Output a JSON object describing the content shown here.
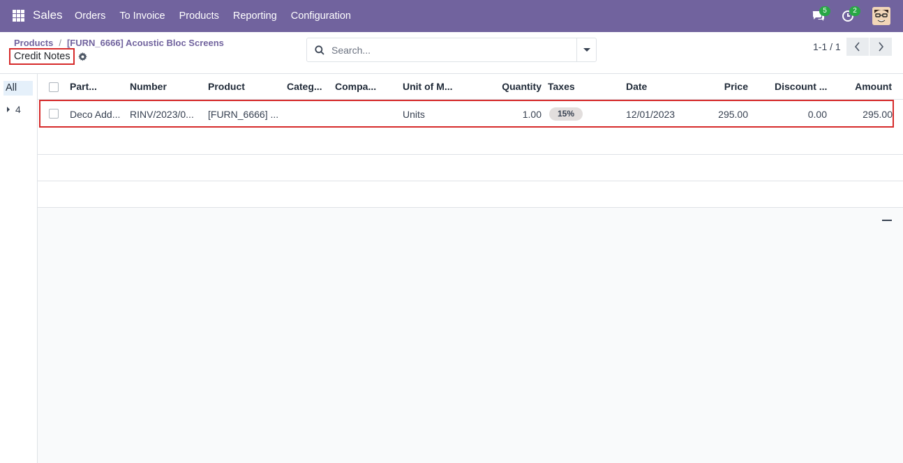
{
  "navbar": {
    "brand": "Sales",
    "menu": [
      "Orders",
      "To Invoice",
      "Products",
      "Reporting",
      "Configuration"
    ],
    "messages_badge": "5",
    "activities_badge": "2",
    "accent_color": "#71639e"
  },
  "breadcrumb": {
    "items": [
      "Products",
      "[FURN_6666] Acoustic Bloc Screens"
    ],
    "separator": "/"
  },
  "page": {
    "title": "Credit Notes"
  },
  "search": {
    "placeholder": "Search..."
  },
  "pager": {
    "value": "1-1 / 1"
  },
  "sidepanel": {
    "all_label": "All",
    "group_count": "4"
  },
  "table": {
    "columns": [
      "Part...",
      "Number",
      "Product",
      "Categ...",
      "Compa...",
      "Unit of M...",
      "Quantity",
      "Taxes",
      "Date",
      "Price",
      "Discount ...",
      "Amount"
    ],
    "rows": [
      {
        "partner": "Deco Add...",
        "number": "RINV/2023/0...",
        "product": "[FURN_6666] ...",
        "category": "",
        "company": "",
        "uom": "Units",
        "quantity": "1.00",
        "taxes": "15%",
        "date": "12/01/2023",
        "price": "295.00",
        "discount": "0.00",
        "amount": "295.00"
      }
    ]
  }
}
